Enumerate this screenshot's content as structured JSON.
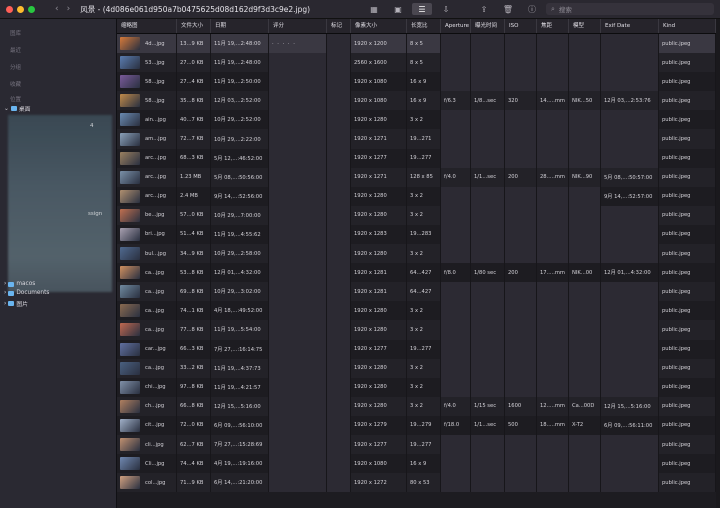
{
  "window": {
    "title": "风景 - (4d086e061d950a7b0475625d08d162d9f3d3c9e2.jpg)",
    "lights": [
      "#ff5f57",
      "#febc2e",
      "#28c840"
    ],
    "nav_back": "‹",
    "nav_forward": "›",
    "toolbar_icons": [
      "grid-icon",
      "slideshow-icon",
      "list-icon",
      "import-icon",
      "share-icon",
      "trash-icon",
      "info-icon",
      "adjust-icon"
    ],
    "search_placeholder": "搜索"
  },
  "sidebar": {
    "categories": [
      "图库",
      "最近",
      "分组",
      "收藏",
      "位置"
    ],
    "tree": [
      {
        "label": "桌面",
        "open": true
      },
      {
        "label": "macos",
        "open": false
      },
      {
        "label": "Documents",
        "open": false
      },
      {
        "label": "图片",
        "open": false
      }
    ],
    "blurred_tags": [
      "4",
      "ssign"
    ]
  },
  "columns": [
    "缩略图",
    "文件大小",
    "日期",
    "评分",
    "标记",
    "像素大小",
    "长宽比",
    "Aperture",
    "曝光时间",
    "ISO",
    "焦距",
    "模型",
    "Exif Date",
    "Kind"
  ],
  "rating_dots": "· · · · ·",
  "rows": [
    {
      "name": "4d...jpg",
      "size": "13...9 KB",
      "date": "11月 19,...2:48:00",
      "px": "1920 x 1200",
      "ratio": "8 x 5",
      "ap": "",
      "exp": "",
      "iso": "",
      "fl": "",
      "model": "",
      "exif": "",
      "kind": "public.jpeg",
      "thumb": "#d67a3a"
    },
    {
      "name": "53...jpg",
      "size": "27...0 KB",
      "date": "11月 19,...2:48:00",
      "px": "2560 x 1600",
      "ratio": "8 x 5",
      "ap": "",
      "exp": "",
      "iso": "",
      "fl": "",
      "model": "",
      "exif": "",
      "kind": "public.jpeg",
      "thumb": "#5a7db0"
    },
    {
      "name": "58...jpg",
      "size": "27...4 KB",
      "date": "11月 19,...2:50:00",
      "px": "1920 x 1080",
      "ratio": "16 x 9",
      "ap": "",
      "exp": "",
      "iso": "",
      "fl": "",
      "model": "",
      "exif": "",
      "kind": "public.jpeg",
      "thumb": "#7a5a9a"
    },
    {
      "name": "58...jpg",
      "size": "35...8 KB",
      "date": "12月 03,...2:52:00",
      "px": "1920 x 1080",
      "ratio": "16 x 9",
      "ap": "f/6.3",
      "exp": "1/8...sec",
      "iso": "320",
      "fl": "14.....mm",
      "model": "NIK...50",
      "exif": "12月 03,...2:53:76",
      "kind": "public.jpeg",
      "thumb": "#c08a4a"
    },
    {
      "name": "ain...jpg",
      "size": "40...7 KB",
      "date": "10月 29,...2:52:00",
      "px": "1920 x 1280",
      "ratio": "3 x 2",
      "ap": "",
      "exp": "",
      "iso": "",
      "fl": "",
      "model": "",
      "exif": "",
      "kind": "public.jpeg",
      "thumb": "#6a8ab0"
    },
    {
      "name": "am...jpg",
      "size": "72...7 KB",
      "date": "10月 29,...2:22:00",
      "px": "1920 x 1271",
      "ratio": "19...271",
      "ap": "",
      "exp": "",
      "iso": "",
      "fl": "",
      "model": "",
      "exif": "",
      "kind": "public.jpeg",
      "thumb": "#8aa0b8"
    },
    {
      "name": "arc...jpg",
      "size": "68...3 KB",
      "date": "5月 12,...:46:52:00",
      "px": "1920 x 1277",
      "ratio": "19...277",
      "ap": "",
      "exp": "",
      "iso": "",
      "fl": "",
      "model": "",
      "exif": "",
      "kind": "public.jpeg",
      "thumb": "#9a8060"
    },
    {
      "name": "arc...jpg",
      "size": "1.23 MB",
      "date": "5月 08,...:50:56:00",
      "px": "1920 x 1271",
      "ratio": "128 x 85",
      "ap": "f/4.0",
      "exp": "1/1...sec",
      "iso": "200",
      "fl": "28.....mm",
      "model": "NIK...90",
      "exif": "5月 08,...:50:57:00",
      "kind": "public.jpeg",
      "thumb": "#7a90a8"
    },
    {
      "name": "arc...jpg",
      "size": "2.4 MB",
      "date": "9月 14,...:52:56:00",
      "px": "1920 x 1280",
      "ratio": "3 x 2",
      "ap": "",
      "exp": "",
      "iso": "",
      "fl": "",
      "model": "",
      "exif": "9月 14,...:52:57:00",
      "kind": "public.jpeg",
      "thumb": "#b09070"
    },
    {
      "name": "be...jpg",
      "size": "57...0 KB",
      "date": "10月 29,...7:00:00",
      "px": "1920 x 1280",
      "ratio": "3 x 2",
      "ap": "",
      "exp": "",
      "iso": "",
      "fl": "",
      "model": "",
      "exif": "",
      "kind": "public.jpeg",
      "thumb": "#c07050"
    },
    {
      "name": "bri...jpg",
      "size": "51...4 KB",
      "date": "11月 19,...4:55:62",
      "px": "1920 x 1283",
      "ratio": "19...283",
      "ap": "",
      "exp": "",
      "iso": "",
      "fl": "",
      "model": "",
      "exif": "",
      "kind": "public.jpeg",
      "thumb": "#a8a0b0"
    },
    {
      "name": "bul...jpg",
      "size": "34...9 KB",
      "date": "10月 29,...2:58:00",
      "px": "1920 x 1280",
      "ratio": "3 x 2",
      "ap": "",
      "exp": "",
      "iso": "",
      "fl": "",
      "model": "",
      "exif": "",
      "kind": "public.jpeg",
      "thumb": "#506a90"
    },
    {
      "name": "ca...jpg",
      "size": "53...8 KB",
      "date": "12月 01,...4:32:00",
      "px": "1920 x 1281",
      "ratio": "64...427",
      "ap": "f/8.0",
      "exp": "1/80 sec",
      "iso": "200",
      "fl": "17.....mm",
      "model": "NIK...00",
      "exif": "12月 01,...4:32:00",
      "kind": "public.jpeg",
      "thumb": "#d09060"
    },
    {
      "name": "ca...jpg",
      "size": "69...8 KB",
      "date": "10月 29,...3:02:00",
      "px": "1920 x 1281",
      "ratio": "64...427",
      "ap": "",
      "exp": "",
      "iso": "",
      "fl": "",
      "model": "",
      "exif": "",
      "kind": "public.jpeg",
      "thumb": "#708aa0"
    },
    {
      "name": "ca...jpg",
      "size": "74...1 KB",
      "date": "4月 18,...:49:52:00",
      "px": "1920 x 1280",
      "ratio": "3 x 2",
      "ap": "",
      "exp": "",
      "iso": "",
      "fl": "",
      "model": "",
      "exif": "",
      "kind": "public.jpeg",
      "thumb": "#8a6a50"
    },
    {
      "name": "ca...jpg",
      "size": "77...8 KB",
      "date": "11月 19,...5:54:00",
      "px": "1920 x 1280",
      "ratio": "3 x 2",
      "ap": "",
      "exp": "",
      "iso": "",
      "fl": "",
      "model": "",
      "exif": "",
      "kind": "public.jpeg",
      "thumb": "#c06850"
    },
    {
      "name": "car...jpg",
      "size": "66...3 KB",
      "date": "7月 27,...:16:14:75",
      "px": "1920 x 1277",
      "ratio": "19...277",
      "ap": "",
      "exp": "",
      "iso": "",
      "fl": "",
      "model": "",
      "exif": "",
      "kind": "public.jpeg",
      "thumb": "#6070a0"
    },
    {
      "name": "ca...jpg",
      "size": "33...2 KB",
      "date": "11月 19,...4:37:73",
      "px": "1920 x 1280",
      "ratio": "3 x 2",
      "ap": "",
      "exp": "",
      "iso": "",
      "fl": "",
      "model": "",
      "exif": "",
      "kind": "public.jpeg",
      "thumb": "#4a6080"
    },
    {
      "name": "chi...jpg",
      "size": "97...8 KB",
      "date": "11月 19,...4:21:57",
      "px": "1920 x 1280",
      "ratio": "3 x 2",
      "ap": "",
      "exp": "",
      "iso": "",
      "fl": "",
      "model": "",
      "exif": "",
      "kind": "public.jpeg",
      "thumb": "#8090a8"
    },
    {
      "name": "ch...jpg",
      "size": "66...8 KB",
      "date": "12月 15,...5:16:00",
      "px": "1920 x 1280",
      "ratio": "3 x 2",
      "ap": "f/4.0",
      "exp": "1/15 sec",
      "iso": "1600",
      "fl": "12.....mm",
      "model": "Ca...00D",
      "exif": "12月 15,...5:16:00",
      "kind": "public.jpeg",
      "thumb": "#b08060"
    },
    {
      "name": "cit...jpg",
      "size": "72...0 KB",
      "date": "6月 09,...:56:10:00",
      "px": "1920 x 1279",
      "ratio": "19...279",
      "ap": "f/18.0",
      "exp": "1/1...sec",
      "iso": "500",
      "fl": "18.....mm",
      "model": "X-T2",
      "exif": "6月 09,...:56:11:00",
      "kind": "public.jpeg",
      "thumb": "#a0b0c8"
    },
    {
      "name": "cli...jpg",
      "size": "62...7 KB",
      "date": "7月 27,...:15:28:69",
      "px": "1920 x 1277",
      "ratio": "19...277",
      "ap": "",
      "exp": "",
      "iso": "",
      "fl": "",
      "model": "",
      "exif": "",
      "kind": "public.jpeg",
      "thumb": "#c09070"
    },
    {
      "name": "Cli...jpg",
      "size": "74...4 KB",
      "date": "4月 19,...:19:16:00",
      "px": "1920 x 1080",
      "ratio": "16 x 9",
      "ap": "",
      "exp": "",
      "iso": "",
      "fl": "",
      "model": "",
      "exif": "",
      "kind": "public.jpeg",
      "thumb": "#7088b0"
    },
    {
      "name": "col...jpg",
      "size": "71...9 KB",
      "date": "6月 14,...:21:20:00",
      "px": "1920 x 1272",
      "ratio": "80 x 53",
      "ap": "",
      "exp": "",
      "iso": "",
      "fl": "",
      "model": "",
      "exif": "",
      "kind": "public.jpeg",
      "thumb": "#d0a080"
    }
  ]
}
